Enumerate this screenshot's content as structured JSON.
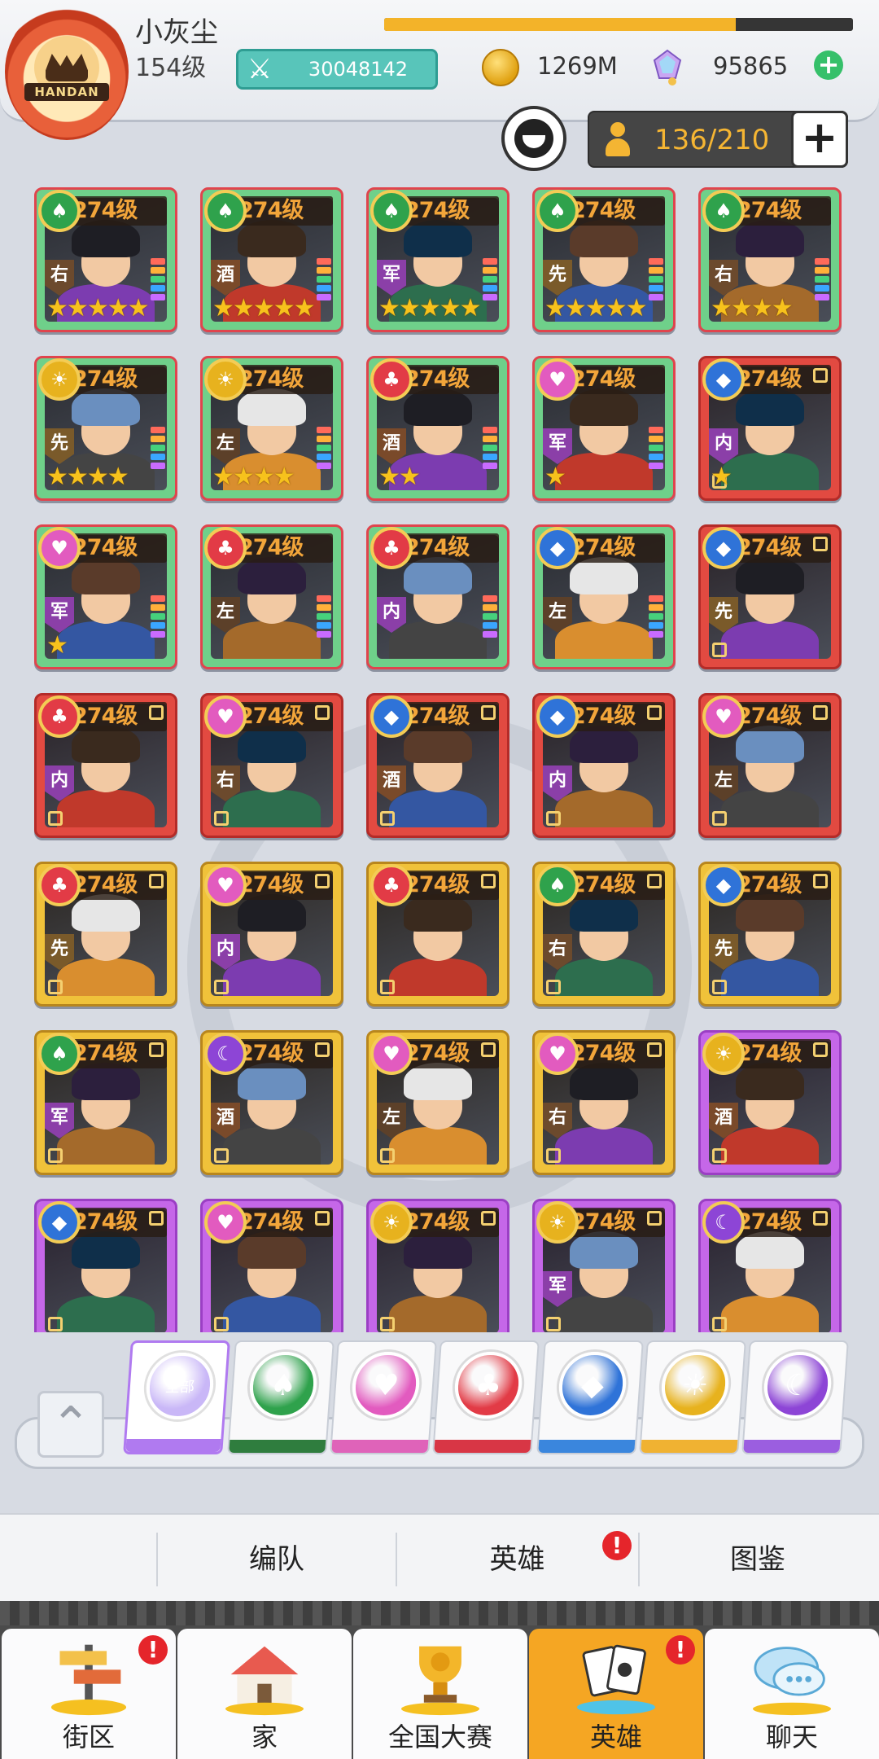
{
  "player": {
    "name": "小灰尘",
    "level": "154级",
    "power": "30048142",
    "gold": "1269M",
    "gems": "95865",
    "xp_progress": 0.75,
    "avatar_text": "HANDAN"
  },
  "roster": {
    "capacity": "136/210"
  },
  "heroes": [
    {
      "level": "274级",
      "suit": "spade",
      "role": "右",
      "stars": 5,
      "frame": "green"
    },
    {
      "level": "274级",
      "suit": "spade",
      "role": "酒",
      "stars": 5,
      "frame": "green"
    },
    {
      "level": "274级",
      "suit": "spade",
      "role": "军",
      "stars": 5,
      "frame": "green"
    },
    {
      "level": "274级",
      "suit": "spade",
      "role": "先",
      "stars": 5,
      "frame": "green"
    },
    {
      "level": "274级",
      "suit": "spade",
      "role": "右",
      "stars": 4,
      "frame": "green"
    },
    {
      "level": "274级",
      "suit": "sun",
      "role": "先",
      "stars": 4,
      "frame": "green"
    },
    {
      "level": "274级",
      "suit": "sun",
      "role": "左",
      "stars": 4,
      "frame": "green"
    },
    {
      "level": "274级",
      "suit": "club",
      "role": "酒",
      "stars": 2,
      "frame": "green"
    },
    {
      "level": "274级",
      "suit": "heart",
      "role": "军",
      "stars": 1,
      "frame": "green"
    },
    {
      "level": "274级",
      "suit": "diamond",
      "role": "内",
      "stars": 1,
      "frame": "red"
    },
    {
      "level": "274级",
      "suit": "heart",
      "role": "军",
      "stars": 1,
      "frame": "green"
    },
    {
      "level": "274级",
      "suit": "club",
      "role": "左",
      "stars": 0,
      "frame": "green"
    },
    {
      "level": "274级",
      "suit": "club",
      "role": "内",
      "stars": 0,
      "frame": "green"
    },
    {
      "level": "274级",
      "suit": "diamond",
      "role": "左",
      "stars": 0,
      "frame": "green"
    },
    {
      "level": "274级",
      "suit": "diamond",
      "role": "先",
      "stars": 0,
      "frame": "red"
    },
    {
      "level": "274级",
      "suit": "club",
      "role": "内",
      "stars": 0,
      "frame": "red"
    },
    {
      "level": "274级",
      "suit": "heart",
      "role": "右",
      "stars": 0,
      "frame": "red"
    },
    {
      "level": "274级",
      "suit": "diamond",
      "role": "酒",
      "stars": 0,
      "frame": "red"
    },
    {
      "level": "274级",
      "suit": "diamond",
      "role": "内",
      "stars": 0,
      "frame": "red"
    },
    {
      "level": "274级",
      "suit": "heart",
      "role": "左",
      "stars": 0,
      "frame": "red"
    },
    {
      "level": "274级",
      "suit": "club",
      "role": "先",
      "stars": 0,
      "frame": "gold"
    },
    {
      "level": "274级",
      "suit": "heart",
      "role": "内",
      "stars": 0,
      "frame": "gold"
    },
    {
      "level": "274级",
      "suit": "club",
      "role": "",
      "stars": 0,
      "frame": "gold"
    },
    {
      "level": "274级",
      "suit": "spade",
      "role": "右",
      "stars": 0,
      "frame": "gold"
    },
    {
      "level": "274级",
      "suit": "diamond",
      "role": "先",
      "stars": 0,
      "frame": "gold"
    },
    {
      "level": "274级",
      "suit": "spade",
      "role": "军",
      "stars": 0,
      "frame": "gold"
    },
    {
      "level": "274级",
      "suit": "moon",
      "role": "酒",
      "stars": 0,
      "frame": "gold"
    },
    {
      "level": "274级",
      "suit": "heart",
      "role": "左",
      "stars": 0,
      "frame": "gold"
    },
    {
      "level": "274级",
      "suit": "heart",
      "role": "右",
      "stars": 0,
      "frame": "gold"
    },
    {
      "level": "274级",
      "suit": "sun",
      "role": "酒",
      "stars": 0,
      "frame": "purple"
    },
    {
      "level": "274级",
      "suit": "diamond",
      "role": "",
      "stars": 0,
      "frame": "purple"
    },
    {
      "level": "274级",
      "suit": "heart",
      "role": "",
      "stars": 0,
      "frame": "purple"
    },
    {
      "level": "274级",
      "suit": "sun",
      "role": "",
      "stars": 0,
      "frame": "purple"
    },
    {
      "level": "274级",
      "suit": "sun",
      "role": "军",
      "stars": 0,
      "frame": "purple"
    },
    {
      "level": "274级",
      "suit": "moon",
      "role": "",
      "stars": 0,
      "frame": "purple"
    }
  ],
  "filters": [
    {
      "name": "all",
      "label": "全部",
      "color": "#c9b7f7",
      "foot": "#b07af0",
      "selected": true
    },
    {
      "name": "spade",
      "color": "#2fa24c",
      "foot": "#2f7d3e"
    },
    {
      "name": "heart",
      "color": "#e25bbf",
      "foot": "#df63b9"
    },
    {
      "name": "club",
      "color": "#e23b46",
      "foot": "#d83645"
    },
    {
      "name": "diamond",
      "color": "#2f73d8",
      "foot": "#3a86dd"
    },
    {
      "name": "sun",
      "color": "#e7b21e",
      "foot": "#f0b232"
    },
    {
      "name": "moon",
      "color": "#8d45d6",
      "foot": "#9b5ee0"
    }
  ],
  "subnav": {
    "team": "编队",
    "heroes": "英雄",
    "codex": "图鉴",
    "alert": "!"
  },
  "bottomnav": [
    {
      "key": "street",
      "label": "街区",
      "alert": "!",
      "icon": "signpost-icon"
    },
    {
      "key": "home",
      "label": "家",
      "alert": "",
      "icon": "house-icon"
    },
    {
      "key": "contest",
      "label": "全国大赛",
      "alert": "",
      "icon": "trophy-icon"
    },
    {
      "key": "heroes",
      "label": "英雄",
      "alert": "!",
      "icon": "cards-icon",
      "active": true
    },
    {
      "key": "chat",
      "label": "聊天",
      "alert": "",
      "icon": "chat-bubble-icon"
    }
  ]
}
